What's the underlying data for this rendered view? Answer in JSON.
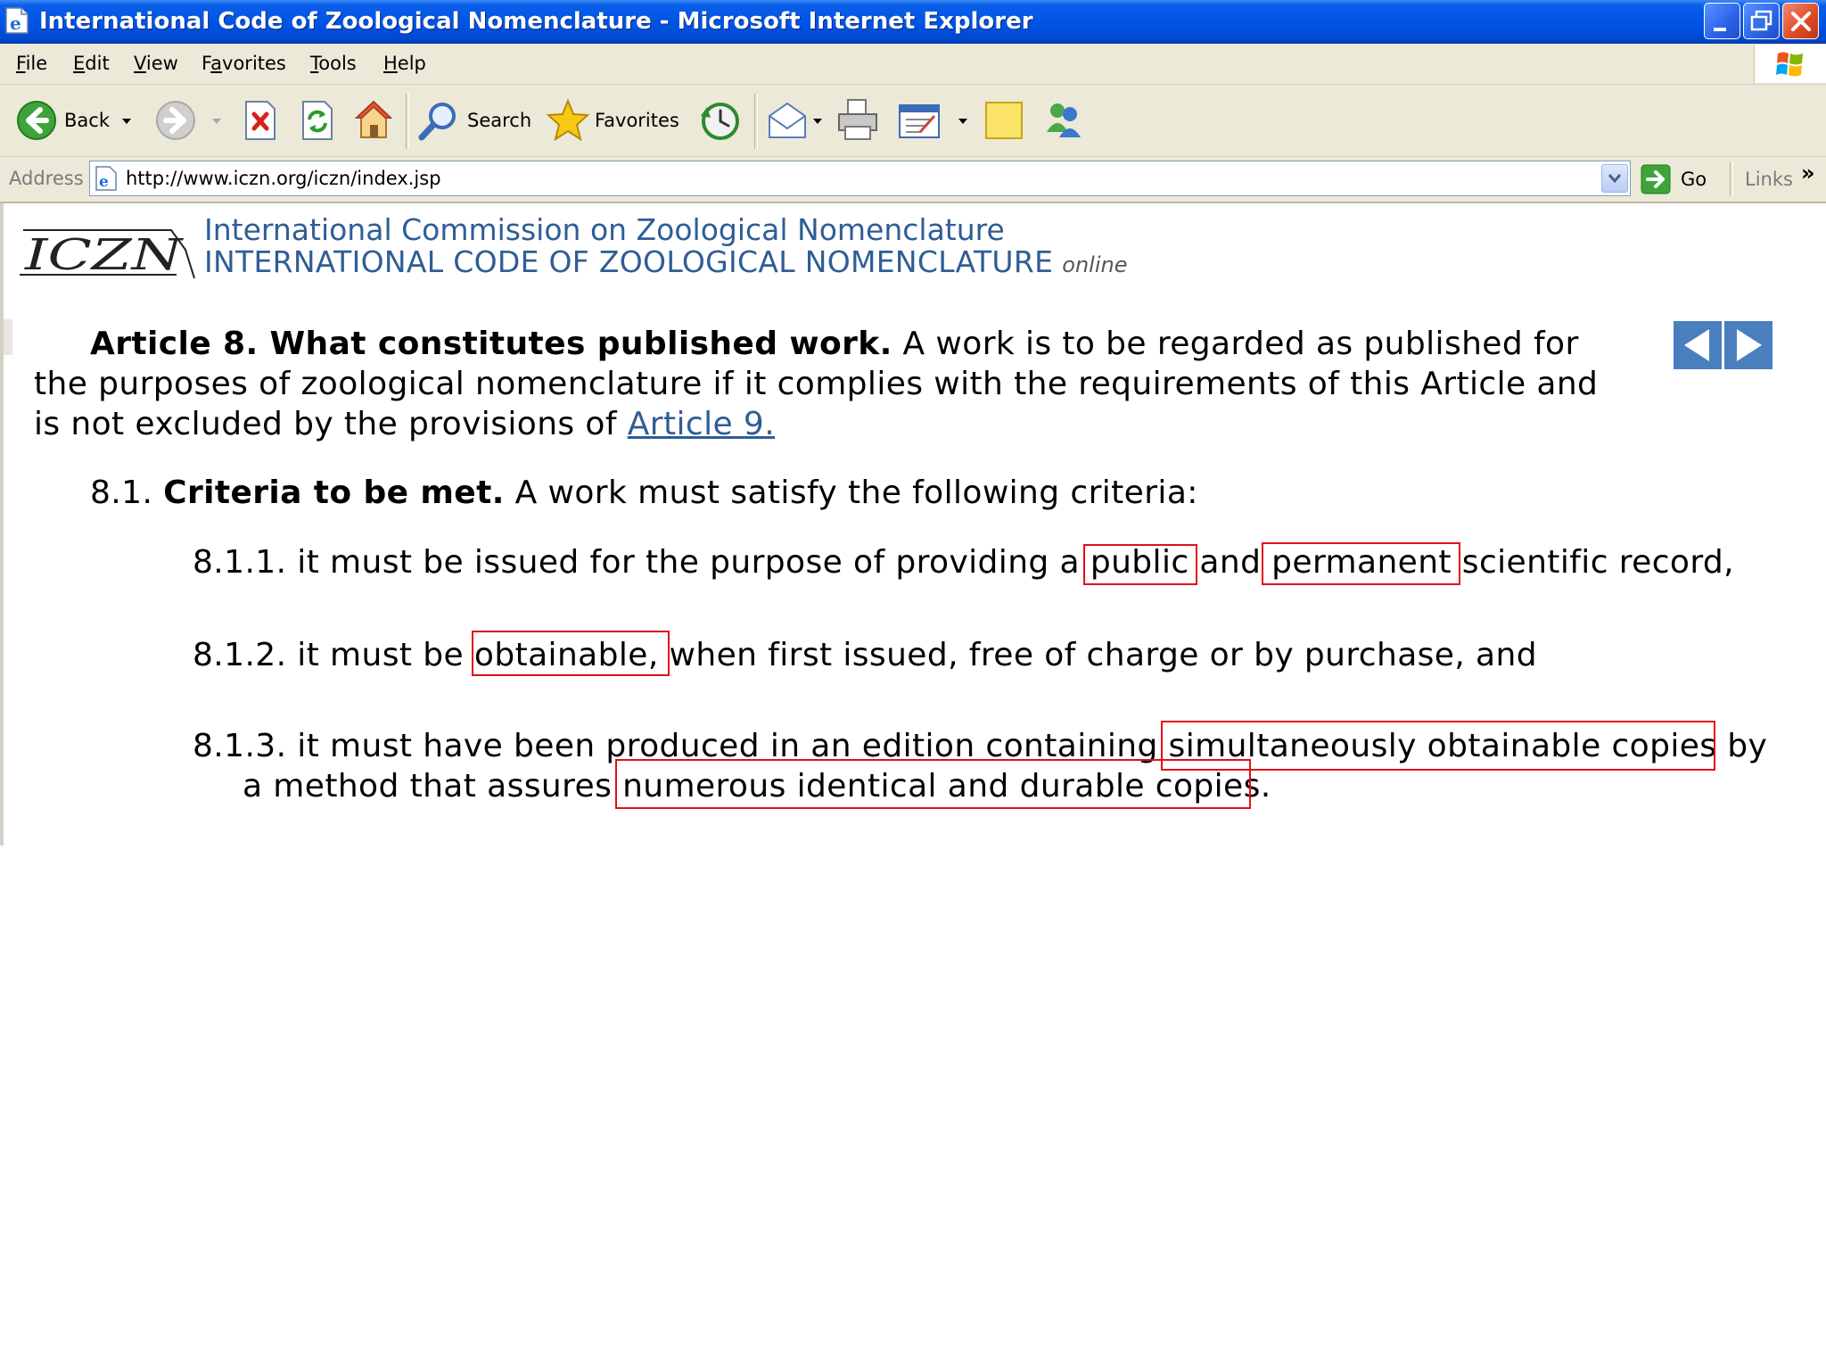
{
  "window": {
    "title": "International Code of Zoological Nomenclature - Microsoft Internet Explorer"
  },
  "menu": {
    "items": [
      {
        "label_ul": "F",
        "label_rest": "ile"
      },
      {
        "label_ul": "E",
        "label_rest": "dit"
      },
      {
        "label_ul": "V",
        "label_rest": "iew"
      },
      {
        "label_pre": "F",
        "label_ul": "a",
        "label_rest": "vorites"
      },
      {
        "label_ul": "T",
        "label_rest": "ools"
      },
      {
        "label_ul": "H",
        "label_rest": "elp"
      }
    ]
  },
  "toolbar": {
    "back_label": "Back",
    "search_label": "Search",
    "favorites_label": "Favorites"
  },
  "address": {
    "label": "Address",
    "url": "http://www.iczn.org/iczn/index.jsp",
    "go_label": "Go",
    "links_label": "Links",
    "links_chevron": "»"
  },
  "site": {
    "logo_text": "ICZN",
    "line1": "International Commission on Zoological Nomenclature",
    "line2": "INTERNATIONAL CODE OF ZOOLOGICAL NOMENCLATURE",
    "online": "online"
  },
  "article": {
    "heading": "Article 8. What constitutes published work.",
    "intro_1": " A work is to be regarded as published for",
    "intro_2": "the purposes of zoological nomenclature if it complies with the requirements of this Article and",
    "intro_3_pre": "is not excluded by the provisions of ",
    "intro_3_link": "Article 9.",
    "s81_num": "8.1. ",
    "s81_title": "Criteria to be met.",
    "s81_text": " A work must satisfy the following criteria:",
    "s811": "8.1.1. it must be issued for the purpose of providing a public and permanent scientific record,",
    "s812": "8.1.2. it must be obtainable, when first issued, free of charge or by purchase, and",
    "s813_1": "8.1.3. it must have been produced in an edition containing simultaneously obtainable copies by",
    "s813_2": "a method that assures numerous identical and durable copies."
  },
  "highlight_color": "#e0101a",
  "link_color": "#2f5d96"
}
